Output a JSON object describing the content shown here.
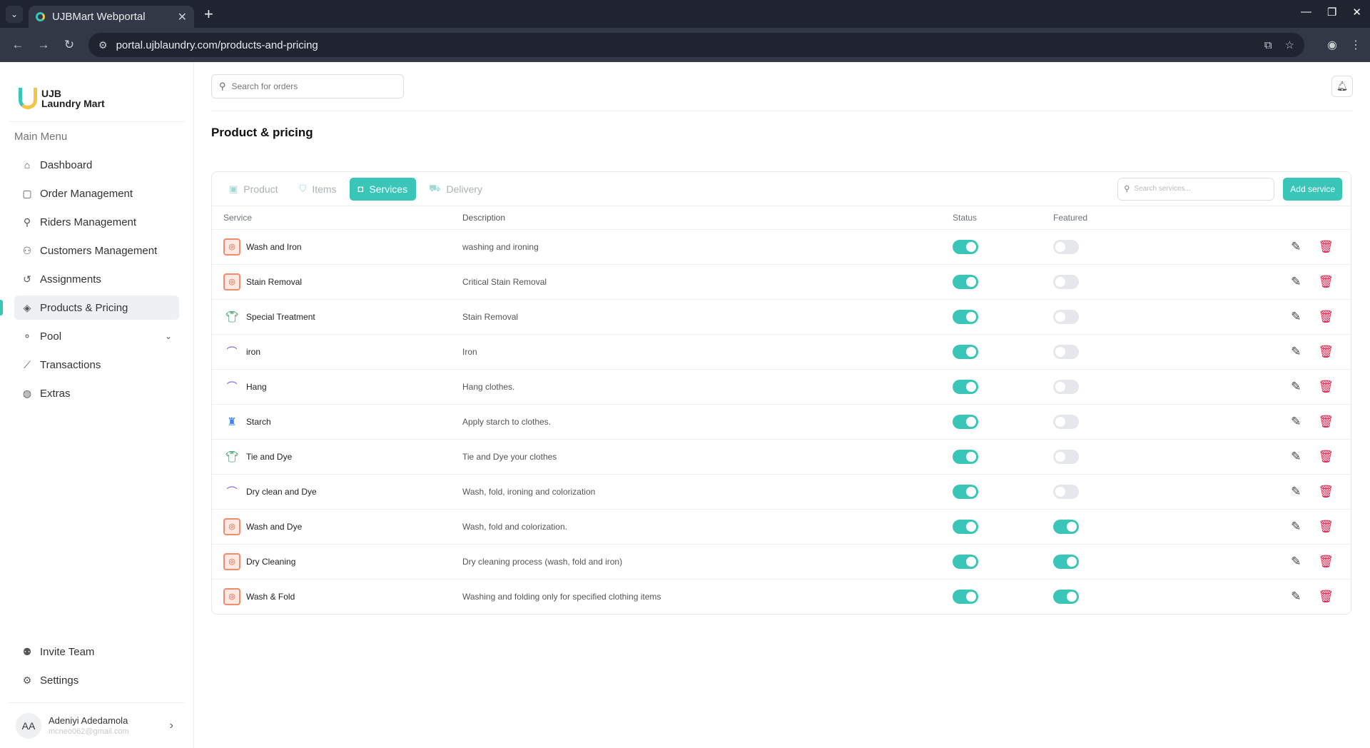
{
  "browser": {
    "tab_title": "UJBMart Webportal",
    "url": "portal.ujblaundry.com/products-and-pricing"
  },
  "sidebar": {
    "logo_line1": "UJB",
    "logo_line2": "Laundry Mart",
    "section": "Main Menu",
    "items": [
      {
        "label": "Dashboard",
        "icon": "home-icon"
      },
      {
        "label": "Order Management",
        "icon": "bag-icon"
      },
      {
        "label": "Riders Management",
        "icon": "bike-icon"
      },
      {
        "label": "Customers Management",
        "icon": "users-icon"
      },
      {
        "label": "Assignments",
        "icon": "history-icon"
      },
      {
        "label": "Products & Pricing",
        "icon": "tag-icon"
      },
      {
        "label": "Pool",
        "icon": "pool-icon"
      },
      {
        "label": "Transactions",
        "icon": "chart-icon"
      },
      {
        "label": "Extras",
        "icon": "globe-icon"
      }
    ],
    "invite": "Invite Team",
    "settings": "Settings",
    "user": {
      "initials": "AA",
      "name": "Adeniyi Adedamola",
      "email": "mcneo062@gmail.com"
    }
  },
  "topbar": {
    "search_placeholder": "Search for orders"
  },
  "page": {
    "title": "Product & pricing",
    "tabs": [
      "Product",
      "Items",
      "Services",
      "Delivery"
    ],
    "active_tab": "Services",
    "service_search_placeholder": "Search services...",
    "add_button": "Add service",
    "columns": [
      "Service",
      "Description",
      "Status",
      "Featured"
    ],
    "rows": [
      {
        "name": "Wash and Iron",
        "desc": "washing and ironing",
        "status": true,
        "featured": false,
        "icon": "washer"
      },
      {
        "name": "Stain Removal",
        "desc": "Critical Stain Removal",
        "status": true,
        "featured": false,
        "icon": "washer"
      },
      {
        "name": "Special Treatment",
        "desc": "Stain Removal",
        "status": true,
        "featured": false,
        "icon": "shirt"
      },
      {
        "name": "iron",
        "desc": "Iron",
        "status": true,
        "featured": false,
        "icon": "hanger"
      },
      {
        "name": "Hang",
        "desc": "Hang clothes.",
        "status": true,
        "featured": false,
        "icon": "hanger"
      },
      {
        "name": "Starch",
        "desc": "Apply starch to clothes.",
        "status": true,
        "featured": false,
        "icon": "bottle"
      },
      {
        "name": "Tie and Dye",
        "desc": "Tie and Dye your clothes",
        "status": true,
        "featured": false,
        "icon": "shirt"
      },
      {
        "name": "Dry clean and Dye",
        "desc": "Wash, fold, ironing and colorization",
        "status": true,
        "featured": false,
        "icon": "hanger"
      },
      {
        "name": "Wash and Dye",
        "desc": "Wash, fold and colorization.",
        "status": true,
        "featured": true,
        "icon": "washer"
      },
      {
        "name": "Dry Cleaning",
        "desc": "Dry cleaning process (wash, fold and iron)",
        "status": true,
        "featured": true,
        "icon": "washer"
      },
      {
        "name": "Wash & Fold",
        "desc": "Washing and folding only for specified clothing items",
        "status": true,
        "featured": true,
        "icon": "washer"
      }
    ]
  },
  "colors": {
    "accent": "#39c6b8",
    "danger": "#e11d48"
  }
}
